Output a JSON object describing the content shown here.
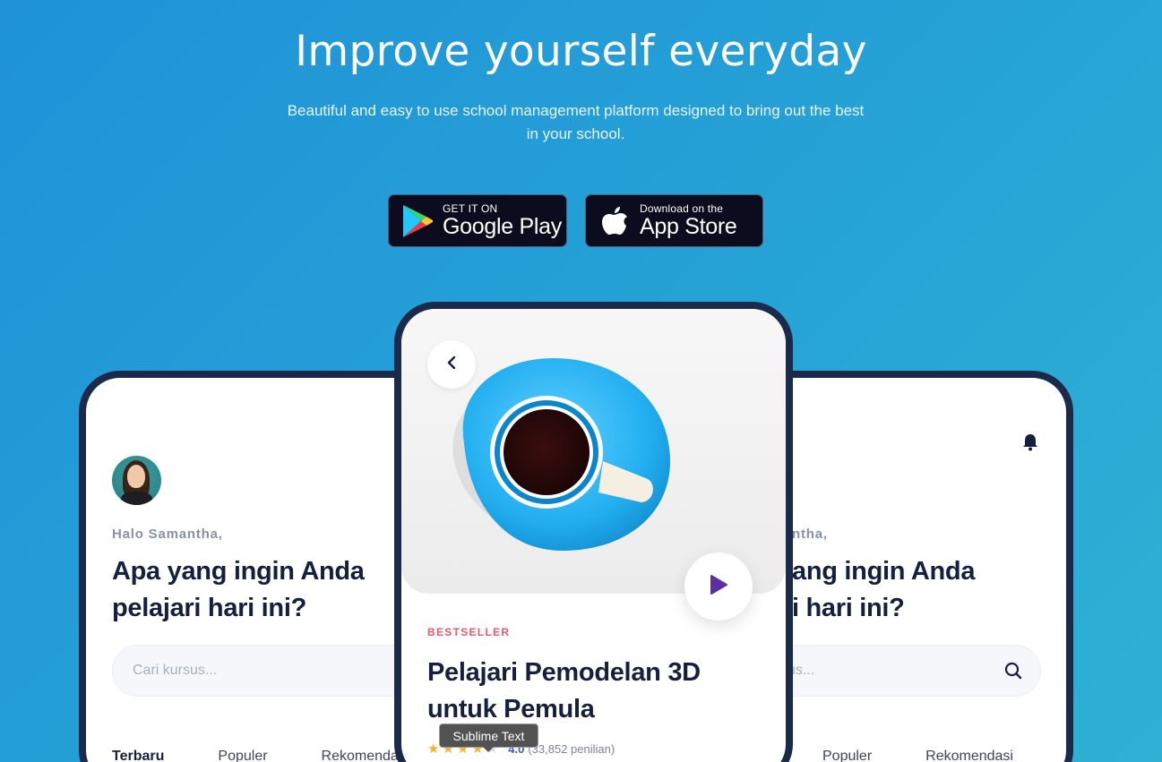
{
  "hero": {
    "title": "Improve yourself everyday",
    "subtitle": "Beautiful and easy to use school management platform designed to bring out the best in your school."
  },
  "stores": {
    "google": {
      "small": "GET IT ON",
      "big": "Google Play",
      "icon": "google-play-icon"
    },
    "apple": {
      "small": "Download on the",
      "big": "App Store",
      "icon": "apple-icon"
    }
  },
  "left_phone": {
    "greeting": "Halo Samantha,",
    "question": "Apa yang ingin Anda pelajari hari ini?",
    "search_placeholder": "Cari kursus...",
    "tabs": [
      "Terbaru",
      "Populer",
      "Rekomendasi"
    ]
  },
  "right_phone": {
    "greeting": "ntha,",
    "question_line1": "ang ingin Anda",
    "question_line2": "i hari ini?",
    "search_placeholder": "sus...",
    "tabs": [
      "Populer",
      "Rekomendasi"
    ]
  },
  "course": {
    "badge": "BESTSELLER",
    "title": "Pelajari Pemodelan 3D untuk Pemula",
    "rating": "4.0",
    "rating_count": "(33,852 penilian)",
    "stars_filled": 4,
    "stars_total": 5
  },
  "tooltip": {
    "text": "Sublime Text"
  },
  "colors": {
    "accent": "#f0586b",
    "dark": "#15203f",
    "play": "#5b2fa6",
    "bg": "#1f92d8"
  }
}
